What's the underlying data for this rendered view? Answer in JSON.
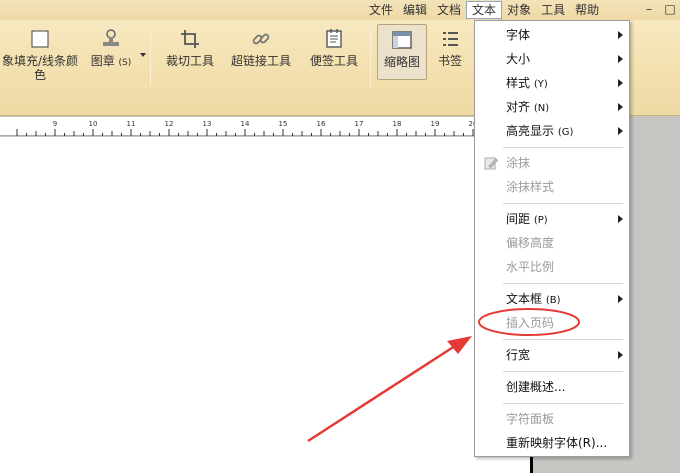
{
  "menubar": {
    "items": [
      "文件",
      "编辑",
      "文档",
      "文本",
      "对象",
      "工具",
      "帮助"
    ],
    "active_index": 3,
    "minimize": "–",
    "restore": "□"
  },
  "toolbar": {
    "fill_label": "象填充/线条颜",
    "fill_label_2": "色",
    "stamp_label": "图章",
    "stamp_key": "(S)",
    "crop_label": "裁切工具",
    "link_label": "超链接工具",
    "note_label": "便签工具",
    "thumb_label": "缩略图",
    "bookmark_label": "书签"
  },
  "ruler": {
    "labels": [
      "9",
      "10",
      "11",
      "12",
      "13",
      "14",
      "15",
      "16",
      "17",
      "18",
      "19",
      "20"
    ]
  },
  "text_menu": {
    "font": "字体",
    "size": "大小",
    "style": "样式",
    "style_key": "(Y)",
    "align": "对齐",
    "align_key": "(N)",
    "highlight": "高亮显示",
    "highlight_key": "(G)",
    "smear": "涂抹",
    "smear_style": "涂抹样式",
    "spacing": "间距",
    "spacing_key": "(P)",
    "offset": "偏移高度",
    "hscale": "水平比例",
    "textbox": "文本框",
    "textbox_key": "(B)",
    "insert_page_number": "插入页码",
    "line_width": "行宽",
    "create_summary": "创建概述...",
    "char_panel": "字符面板",
    "remap_fonts": "重新映射字体(R)..."
  },
  "colors": {
    "annotation": "#e53935",
    "menubar_bg": "#f0dca9",
    "active_menu_border": "#8ea7c7"
  }
}
